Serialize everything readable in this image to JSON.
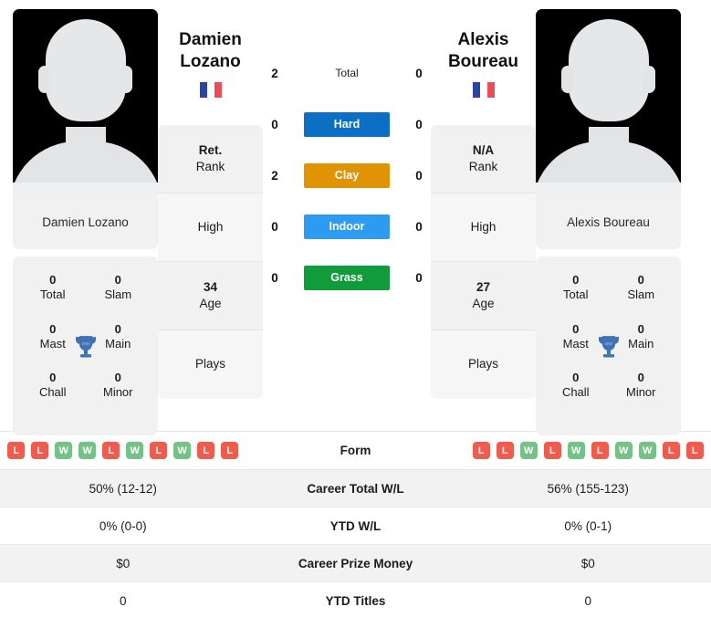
{
  "players": {
    "left": {
      "first_name": "Damien",
      "last_name": "Lozano",
      "full_name": "Damien Lozano",
      "flag": "france-flag-icon",
      "photo": "player-photo-placeholder",
      "titles": {
        "total": {
          "value": "0",
          "label": "Total"
        },
        "slam": {
          "value": "0",
          "label": "Slam"
        },
        "mast": {
          "value": "0",
          "label": "Mast"
        },
        "main": {
          "value": "0",
          "label": "Main"
        },
        "chall": {
          "value": "0",
          "label": "Chall"
        },
        "minor": {
          "value": "0",
          "label": "Minor"
        }
      },
      "info": {
        "rank_value": "Ret.",
        "rank_label": "Rank",
        "high_label": "High",
        "high_value": "",
        "age_value": "34",
        "age_label": "Age",
        "plays_label": "Plays",
        "plays_value": ""
      },
      "form": [
        "L",
        "L",
        "W",
        "W",
        "L",
        "W",
        "L",
        "W",
        "L",
        "L"
      ],
      "career_total_wl": "50% (12-12)",
      "ytd_wl": "0% (0-0)",
      "career_prize_money": "$0",
      "ytd_titles": "0"
    },
    "right": {
      "first_name": "Alexis",
      "last_name": "Boureau",
      "full_name": "Alexis Boureau",
      "flag": "france-flag-icon",
      "photo": "player-photo-placeholder",
      "titles": {
        "total": {
          "value": "0",
          "label": "Total"
        },
        "slam": {
          "value": "0",
          "label": "Slam"
        },
        "mast": {
          "value": "0",
          "label": "Mast"
        },
        "main": {
          "value": "0",
          "label": "Main"
        },
        "chall": {
          "value": "0",
          "label": "Chall"
        },
        "minor": {
          "value": "0",
          "label": "Minor"
        }
      },
      "info": {
        "rank_value": "N/A",
        "rank_label": "Rank",
        "high_label": "High",
        "high_value": "",
        "age_value": "27",
        "age_label": "Age",
        "plays_label": "Plays",
        "plays_value": ""
      },
      "form": [
        "L",
        "L",
        "W",
        "L",
        "W",
        "L",
        "W",
        "W",
        "L",
        "L"
      ],
      "career_total_wl": "56% (155-123)",
      "ytd_wl": "0% (0-1)",
      "career_prize_money": "$0",
      "ytd_titles": "0"
    }
  },
  "head_to_head": [
    {
      "label": "Total",
      "left": "2",
      "right": "0",
      "style": "plain",
      "color": ""
    },
    {
      "label": "Hard",
      "left": "0",
      "right": "0",
      "style": "badge",
      "color": "#0b70c4"
    },
    {
      "label": "Clay",
      "left": "2",
      "right": "0",
      "style": "badge",
      "color": "#e09404"
    },
    {
      "label": "Indoor",
      "left": "0",
      "right": "0",
      "style": "badge",
      "color": "#2e9bf0"
    },
    {
      "label": "Grass",
      "left": "0",
      "right": "0",
      "style": "badge",
      "color": "#119c3c"
    }
  ],
  "stats_table": [
    {
      "key": "form",
      "label": "Form",
      "type": "form"
    },
    {
      "key": "career_total_wl",
      "label": "Career Total W/L",
      "left": "50% (12-12)",
      "right": "56% (155-123)",
      "type": "text"
    },
    {
      "key": "ytd_wl",
      "label": "YTD W/L",
      "left": "0% (0-0)",
      "right": "0% (0-1)",
      "type": "text"
    },
    {
      "key": "career_prize_money",
      "label": "Career Prize Money",
      "left": "$0",
      "right": "$0",
      "type": "text"
    },
    {
      "key": "ytd_titles",
      "label": "YTD Titles",
      "left": "0",
      "right": "0",
      "type": "text"
    }
  ],
  "colors": {
    "win": "#74c286",
    "loss": "#ef5b4c",
    "hard": "#0b70c4",
    "clay": "#e09404",
    "indoor": "#2e9bf0",
    "grass": "#119c3c",
    "card_bg": "#f1f1f1",
    "row_shade": "#f2f2f2",
    "trophy": "#3f72b5"
  }
}
